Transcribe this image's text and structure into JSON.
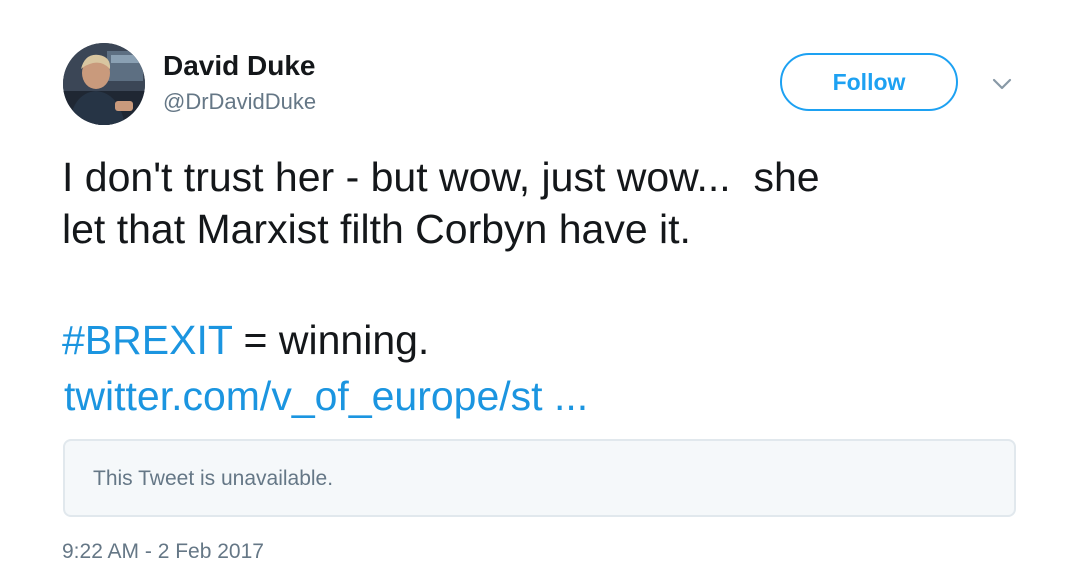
{
  "author": {
    "display_name": "David Duke",
    "handle": "@DrDavidDuke"
  },
  "header": {
    "follow_label": "Follow",
    "more_icon": "chevron-down-icon"
  },
  "tweet": {
    "text_lines": [
      "I don't trust her - but wow, just wow...  she",
      "let that Marxist filth Corbyn have it."
    ],
    "hashtag": "#BREXIT",
    "hashtag_suffix": " = winning.",
    "link": "twitter.com/v_of_europe/st ...",
    "quoted_card_text": "This Tweet is unavailable.",
    "timestamp": "9:22 AM - 2 Feb 2017"
  },
  "colors": {
    "accent": "#1da1f2",
    "link": "#1b95e0",
    "text": "#14171a",
    "muted": "#657786",
    "card_bg": "#f5f8fa",
    "card_border": "#e1e8ed"
  }
}
